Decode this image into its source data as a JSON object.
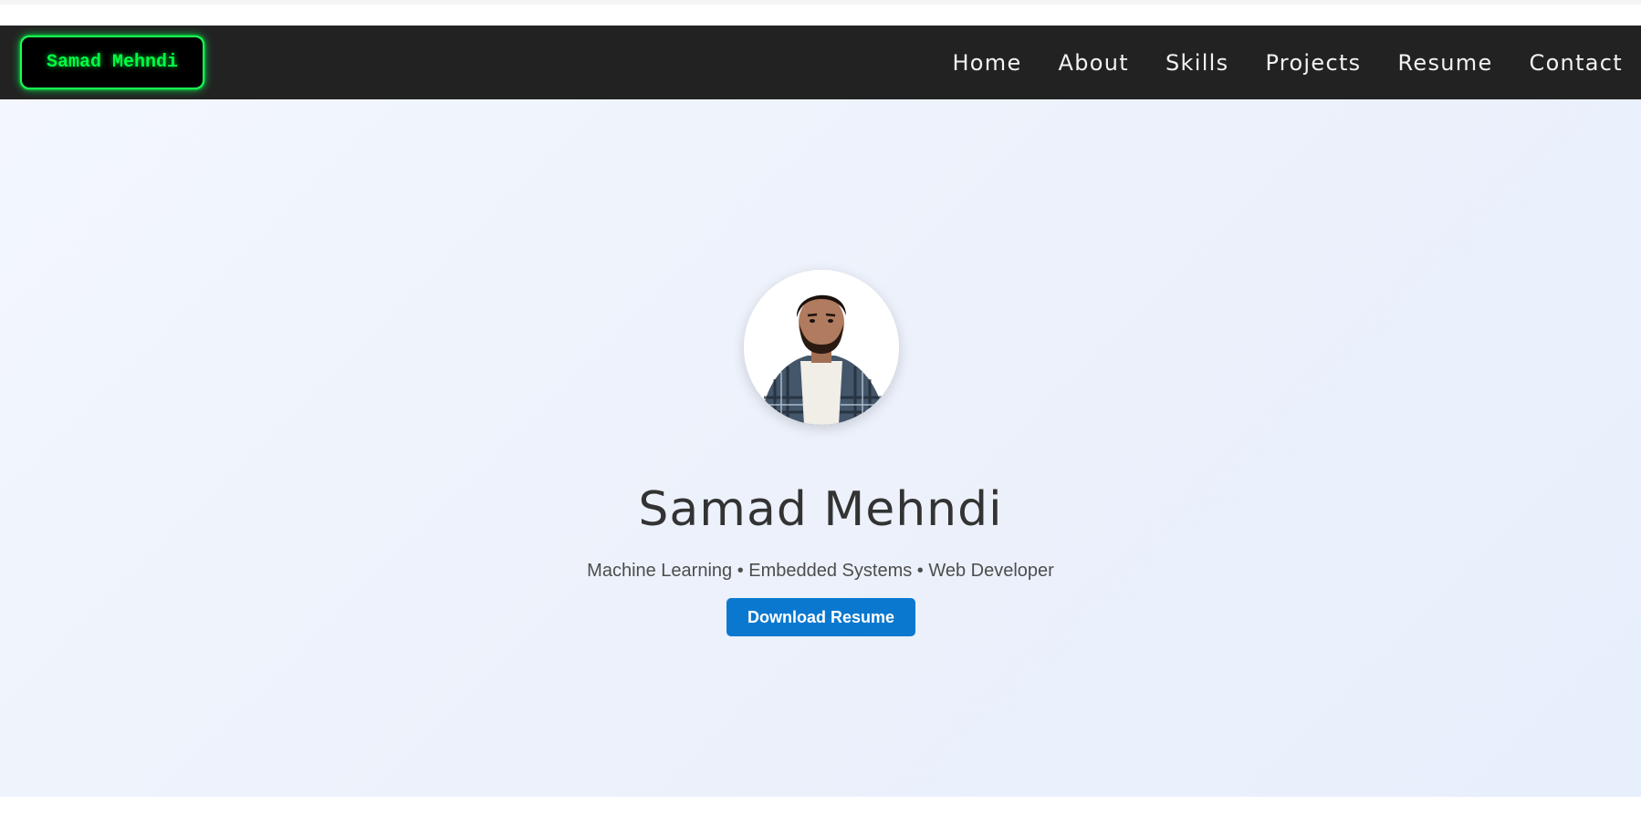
{
  "nav": {
    "logo": "Samad Mehndi",
    "links": [
      "Home",
      "About",
      "Skills",
      "Projects",
      "Resume",
      "Contact"
    ]
  },
  "hero": {
    "name": "Samad Mehndi",
    "tagline": "Machine Learning • Embedded Systems • Web Developer",
    "button_label": "Download Resume"
  },
  "colors": {
    "navbar": "#222222",
    "logo_glow": "#00ff44",
    "button": "#0a78cf",
    "hero_bg": "#eef3fc"
  }
}
